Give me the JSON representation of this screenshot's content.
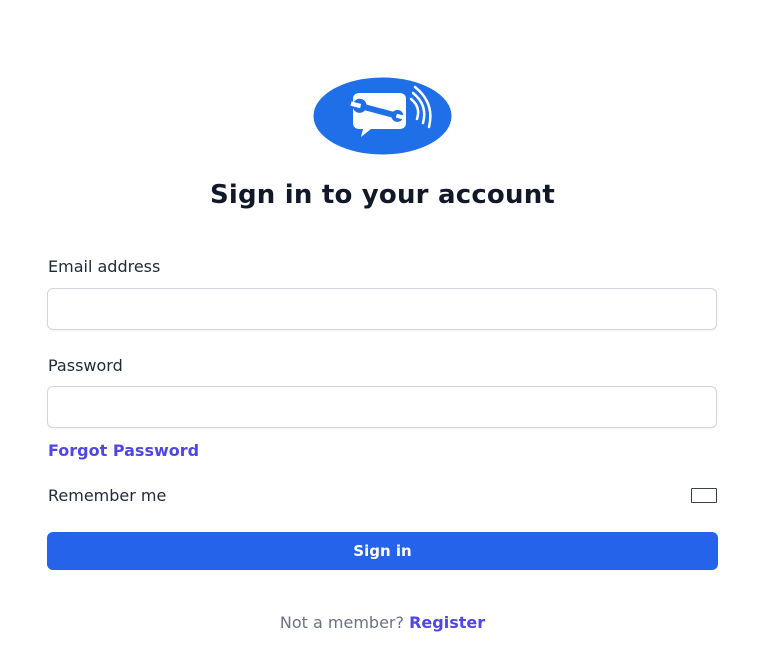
{
  "brand": {
    "logo_icon": "wrench-chat-bubble-icon",
    "color": "#1f6fe8"
  },
  "title": "Sign in to your account",
  "email": {
    "label": "Email address",
    "value": "",
    "placeholder": ""
  },
  "password": {
    "label": "Password",
    "value": "",
    "placeholder": ""
  },
  "forgot_password": "Forgot Password",
  "remember_me": {
    "label": "Remember me",
    "checked": false
  },
  "sign_in_button": "Sign in",
  "footer": {
    "prompt": "Not a member?",
    "register_link": "Register"
  },
  "colors": {
    "primary_button": "#2563eb",
    "link": "#4f46e5",
    "border": "#d1d5db",
    "text": "#111827",
    "muted": "#6b7280"
  }
}
